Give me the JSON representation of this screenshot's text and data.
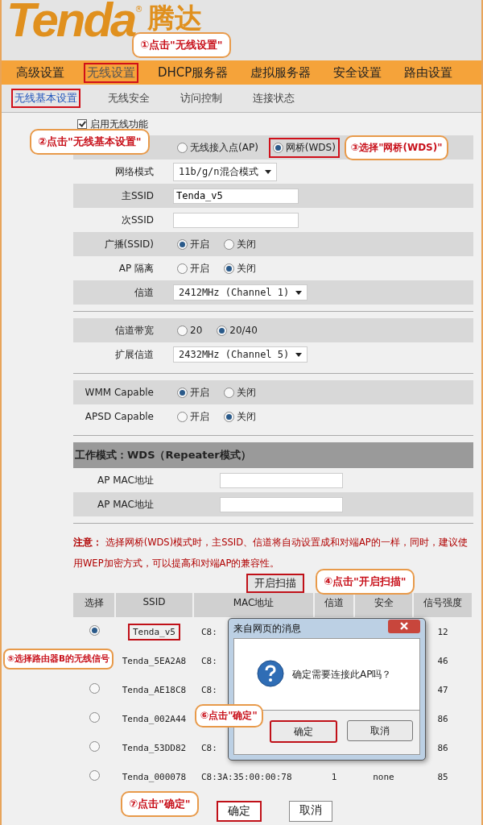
{
  "header": {
    "logo": "Tenda",
    "registered_mark": "®",
    "logo_cn": "腾达"
  },
  "nav": {
    "tabs": [
      {
        "label": "高级设置",
        "selected": false,
        "highlighted": false
      },
      {
        "label": "无线设置",
        "selected": true,
        "highlighted": true
      },
      {
        "label": "DHCP服务器",
        "selected": false,
        "highlighted": false
      },
      {
        "label": "虚拟服务器",
        "selected": false,
        "highlighted": false
      },
      {
        "label": "安全设置",
        "selected": false,
        "highlighted": false
      },
      {
        "label": "路由设置",
        "selected": false,
        "highlighted": false
      }
    ]
  },
  "subnav": {
    "tabs": [
      {
        "label": "无线基本设置",
        "selected": true,
        "highlighted": true
      },
      {
        "label": "无线安全",
        "selected": false,
        "highlighted": false
      },
      {
        "label": "访问控制",
        "selected": false,
        "highlighted": false
      },
      {
        "label": "连接状态",
        "selected": false,
        "highlighted": false
      }
    ]
  },
  "enable_wireless": {
    "label": "启用无线功能",
    "checked": true
  },
  "sections": [
    {
      "rows": [
        {
          "kind": "radio",
          "options": [
            {
              "label": "无线接入点(AP)",
              "selected": false,
              "highlighted": false
            },
            {
              "label": "网桥(WDS)",
              "selected": true,
              "highlighted": true
            }
          ]
        },
        {
          "kind": "select",
          "label": "网络模式",
          "value": "11b/g/n混合模式"
        },
        {
          "kind": "input",
          "label": "主SSID",
          "value": "Tenda_v5"
        },
        {
          "kind": "input",
          "label": "次SSID"
        },
        {
          "kind": "radio",
          "label": "广播(SSID)",
          "options": [
            {
              "label": "开启",
              "selected": true
            },
            {
              "label": "关闭",
              "selected": false
            }
          ]
        },
        {
          "kind": "radio",
          "label": "AP 隔离",
          "options": [
            {
              "label": "开启",
              "selected": false
            },
            {
              "label": "关闭",
              "selected": true
            }
          ]
        },
        {
          "kind": "select",
          "label": "信道",
          "value": "2412MHz (Channel 1)"
        }
      ]
    },
    {
      "rows": [
        {
          "kind": "radio",
          "label": "信道带宽",
          "options": [
            {
              "label": "20",
              "selected": false
            },
            {
              "label": "20/40",
              "selected": true
            }
          ]
        },
        {
          "kind": "select",
          "label": "扩展信道",
          "value": "2432MHz (Channel 5)"
        }
      ]
    },
    {
      "rows": [
        {
          "kind": "radio",
          "label": "WMM Capable",
          "options": [
            {
              "label": "开启",
              "selected": true
            },
            {
              "label": "关闭",
              "selected": false
            }
          ]
        },
        {
          "kind": "radio",
          "label": "APSD Capable",
          "options": [
            {
              "label": "开启",
              "selected": false
            },
            {
              "label": "关闭",
              "selected": true
            }
          ]
        }
      ]
    },
    {
      "title": "工作模式：WDS（Repeater模式）",
      "rows": [
        {
          "kind": "input",
          "label": "AP MAC地址"
        },
        {
          "kind": "input",
          "label": "AP MAC地址"
        }
      ]
    }
  ],
  "note": "**注意：** 选择网桥(WDS)模式时，主SSID、信道将自动设置成和对端AP的一样，同时，建议使用WEP加密方式，可以提高和对端AP的兼容性。",
  "scan_button": {
    "label": "开启扫描",
    "highlighted": true
  },
  "ap_table": {
    "columns": [
      "选择",
      "SSID",
      "MAC地址",
      "信道",
      "安全",
      "信号强度"
    ],
    "rows": [
      {
        "selected": true,
        "highlighted": true,
        "ssid": "Tenda_v5",
        "mac": "C8:",
        "signal": "12"
      },
      {
        "highlighted": false,
        "ssid": "Tenda_5EA2A8",
        "mac": "C8:",
        "signal": "46"
      },
      {
        "selected": false,
        "highlighted": false,
        "ssid": "Tenda_AE18C8",
        "mac": "C8:",
        "signal": "47"
      },
      {
        "selected": false,
        "highlighted": false,
        "ssid": "Tenda_002A44",
        "signal": "86"
      },
      {
        "selected": false,
        "highlighted": false,
        "ssid": "Tenda_53DD82",
        "mac": "C8:",
        "signal": "86"
      },
      {
        "selected": false,
        "highlighted": false,
        "ssid": "Tenda_000078",
        "mac": "C8:3A:35:00:00:78",
        "channel": "1",
        "security": "none",
        "signal": "85"
      }
    ]
  },
  "dialog": {
    "title": "来自网页的消息",
    "message": "确定需要连接此AP吗？",
    "buttons": [
      {
        "label": "确定",
        "highlighted": true
      },
      {
        "label": "取消",
        "highlighted": false
      }
    ]
  },
  "buttons": [
    {
      "label": "确定",
      "highlighted": true
    },
    {
      "label": "取消",
      "highlighted": false
    }
  ],
  "callouts": [
    {
      "text": "①点击\"无线设置\""
    },
    {
      "text": "②点击\"无线基本设置\""
    },
    {
      "text": "③选择\"网桥(WDS)\""
    },
    {
      "text": "④点击\"开启扫描\""
    },
    {
      "text": "⑤选择路由器B的无线信号"
    },
    {
      "text": "⑥点击\"确定\""
    },
    {
      "text": "⑦点击\"确定\""
    }
  ]
}
